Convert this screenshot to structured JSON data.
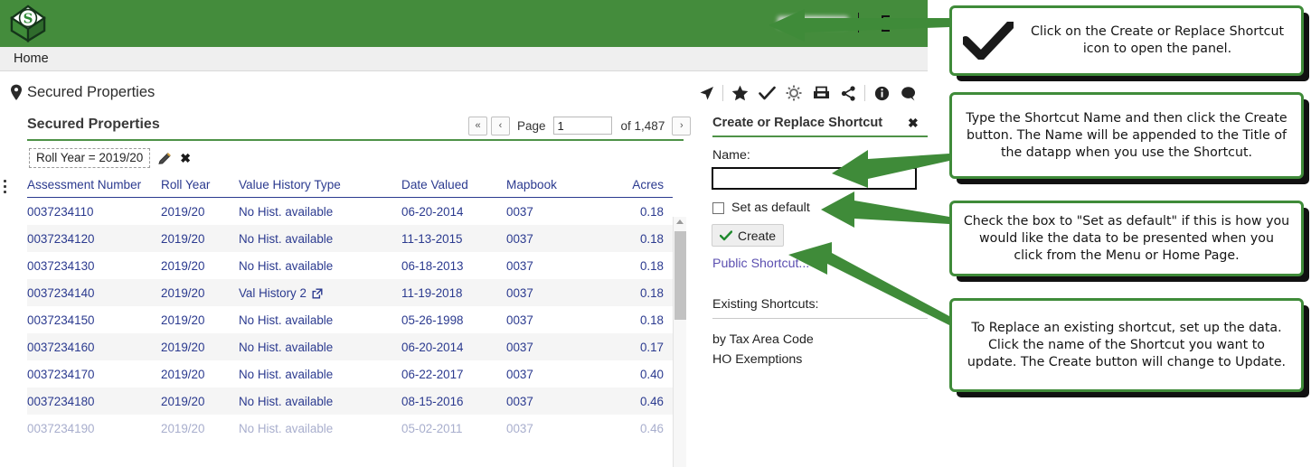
{
  "theme": {
    "green": "#448c3c",
    "accent_green": "#4e9247",
    "link_blue": "#2b3a8f",
    "purple": "#5b4fb0"
  },
  "topbar": {
    "logo_name": "company-diamond-logo",
    "logout_icon": "logout-icon"
  },
  "breadcrumb": {
    "home": "Home"
  },
  "page": {
    "title": "Secured Properties",
    "pin_icon": "location-pin-icon"
  },
  "card": {
    "title": "Secured Properties"
  },
  "pager": {
    "first": "«",
    "prev": "‹",
    "page_label": "Page",
    "page_value": "1",
    "of_label": "of 1,487",
    "next": "›",
    "last": "»"
  },
  "filter": {
    "chip": "Roll Year = 2019/20",
    "edit_icon": "pencil-icon",
    "remove_icon": "close-x-icon"
  },
  "table": {
    "kebab_icon": "column-options-icon",
    "columns": [
      "Assessment Number",
      "Roll Year",
      "Value History Type",
      "Date Valued",
      "Mapbook",
      "Acres"
    ],
    "rows": [
      {
        "assessment": "0037234110",
        "roll_year": "2019/20",
        "history": "No Hist. available",
        "link": false,
        "date": "06-20-2014",
        "mapbook": "0037",
        "acres": "0.18"
      },
      {
        "assessment": "0037234120",
        "roll_year": "2019/20",
        "history": "No Hist. available",
        "link": false,
        "date": "11-13-2015",
        "mapbook": "0037",
        "acres": "0.18"
      },
      {
        "assessment": "0037234130",
        "roll_year": "2019/20",
        "history": "No Hist. available",
        "link": false,
        "date": "06-18-2013",
        "mapbook": "0037",
        "acres": "0.18"
      },
      {
        "assessment": "0037234140",
        "roll_year": "2019/20",
        "history": "Val History 2",
        "link": true,
        "date": "11-19-2018",
        "mapbook": "0037",
        "acres": "0.18"
      },
      {
        "assessment": "0037234150",
        "roll_year": "2019/20",
        "history": "No Hist. available",
        "link": false,
        "date": "05-26-1998",
        "mapbook": "0037",
        "acres": "0.18"
      },
      {
        "assessment": "0037234160",
        "roll_year": "2019/20",
        "history": "No Hist. available",
        "link": false,
        "date": "06-20-2014",
        "mapbook": "0037",
        "acres": "0.17"
      },
      {
        "assessment": "0037234170",
        "roll_year": "2019/20",
        "history": "No Hist. available",
        "link": false,
        "date": "06-22-2017",
        "mapbook": "0037",
        "acres": "0.40"
      },
      {
        "assessment": "0037234180",
        "roll_year": "2019/20",
        "history": "No Hist. available",
        "link": false,
        "date": "08-15-2016",
        "mapbook": "0037",
        "acres": "0.46"
      },
      {
        "assessment": "0037234190",
        "roll_year": "2019/20",
        "history": "No Hist. available",
        "link": false,
        "date": "05-02-2011",
        "mapbook": "0037",
        "acres": "0.46"
      }
    ]
  },
  "toolbar": {
    "icons": [
      "navigate-arrow-icon",
      "star-favorite-icon",
      "checkmark-shortcut-icon",
      "gear-settings-icon",
      "save-export-icon",
      "share-icon",
      "info-icon",
      "comment-icon"
    ]
  },
  "panel": {
    "title": "Create or Replace Shortcut",
    "close_icon": "close-panel-icon",
    "name_label": "Name:",
    "name_value": "",
    "name_placeholder": "",
    "set_default_label": "Set as default",
    "set_default_checked": false,
    "create_label": "Create",
    "create_check_icon": "green-check-icon",
    "public_shortcut_label": "Public Shortcut...",
    "existing_label": "Existing Shortcuts:",
    "existing": [
      "by Tax Area Code",
      "HO Exemptions"
    ]
  },
  "callouts": [
    {
      "icon": "black-checkmark-icon",
      "text": "Click on the Create or Replace Shortcut icon to open the panel."
    },
    {
      "icon": null,
      "text": "Type the Shortcut Name and then click the Create button. The Name will be appended to the Title of the datapp when you use the Shortcut."
    },
    {
      "icon": null,
      "text": "Check the box to \"Set as default\" if this is how you would like the data to be presented when you click from the Menu or Home Page."
    },
    {
      "icon": null,
      "text": "To Replace an existing shortcut, set up the data. Click the name of the Shortcut you want to update. The Create button will change to Update."
    }
  ]
}
